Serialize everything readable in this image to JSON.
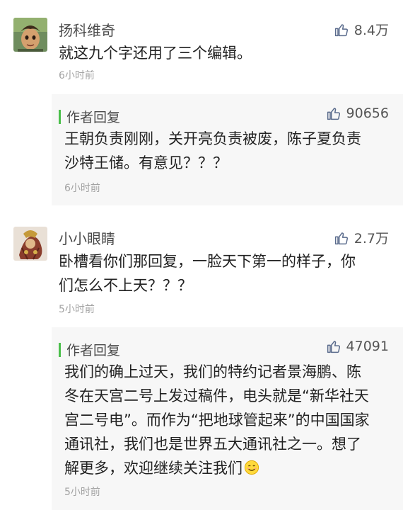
{
  "comments": [
    {
      "username": "扬科维奇",
      "likes": "8.4万",
      "text": "就这九个字还用了三个编辑。",
      "time": "6小时前",
      "reply": {
        "label": "作者回复",
        "likes": "90656",
        "text_lines": [
          "王朝负责刚刚，关开亮负责被废，陈子夏负责",
          "沙特王储。有意见？？？"
        ],
        "time": "6小时前"
      }
    },
    {
      "username": "小小眼睛",
      "likes": "2.7万",
      "text_lines": [
        "卧槽看你们那回复，一脸天下第一的样子，你",
        "们怎么不上天？？？"
      ],
      "time": "5小时前",
      "reply": {
        "label": "作者回复",
        "likes": "47091",
        "text_lines": [
          "我们的确上过天，我们的特约记者景海鹏、陈",
          "冬在天宫二号上发过稿件，电头就是“新华社天",
          "宫二号电”。而作为“把地球管起来”的中国国家",
          "通讯社，我们也是世界五大通讯社之一。想了",
          "解更多，欢迎继续关注我们"
        ],
        "time": "5小时前"
      }
    }
  ],
  "icons": {
    "like": "thumbs-up-icon",
    "emoji": "smiling-face-emoji-icon"
  },
  "colors": {
    "reply_accent": "#4bbf4b",
    "reply_background": "#f7f7f7",
    "time": "#a3a3a3",
    "like_icon": "#5a6b8c"
  }
}
